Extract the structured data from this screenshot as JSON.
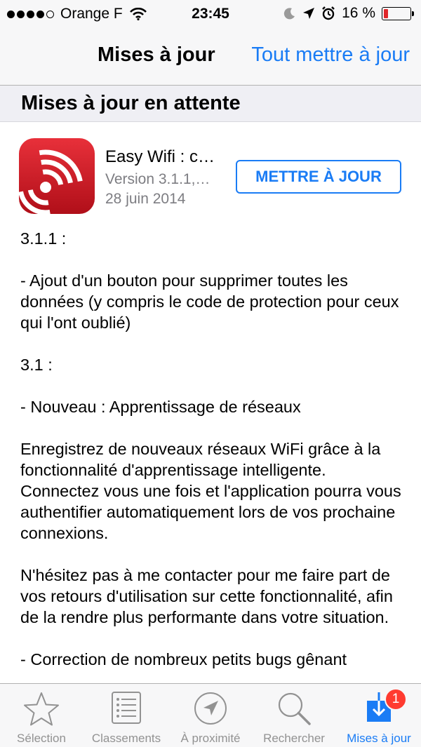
{
  "status_bar": {
    "carrier": "Orange F",
    "time": "23:45",
    "battery": "16 %",
    "battery_level": 0.16,
    "signal_bars": 4,
    "icons": [
      "wifi-icon",
      "moon-icon",
      "location-arrow-icon",
      "alarm-icon",
      "battery-icon"
    ]
  },
  "nav": {
    "title": "Mises à jour",
    "action": "Tout mettre à jour"
  },
  "section": {
    "title": "Mises à jour en attente"
  },
  "app": {
    "name": "Easy Wifi : c…",
    "version": "Version 3.1.1,…",
    "date": "28 juin 2014",
    "update_button": "METTRE À JOUR",
    "icon": "wifi-signal-icon",
    "icon_color": "#d8202b"
  },
  "notes": [
    "3.1.1 :",
    "- Ajout d'un bouton pour supprimer toutes les données (y compris le code de protection pour ceux qui l'ont oublié)",
    "3.1 :",
    "- Nouveau : Apprentissage de réseaux",
    "Enregistrez de nouveaux réseaux WiFi grâce à la fonctionnalité d'apprentissage intelligente. Connectez vous une fois et l'application pourra vous authentifier automatiquement lors de vos prochaine connexions.",
    "N'hésitez pas à me contacter pour me faire part de vos retours d'utilisation sur cette fonctionnalité, afin de la rendre plus performante dans votre situation.",
    "- Correction de nombreux petits bugs gênant"
  ],
  "tabs": [
    {
      "label": "Sélection",
      "icon": "star-icon"
    },
    {
      "label": "Classements",
      "icon": "list-icon"
    },
    {
      "label": "À proximité",
      "icon": "location-icon"
    },
    {
      "label": "Rechercher",
      "icon": "search-icon"
    },
    {
      "label": "Mises à jour",
      "icon": "download-icon",
      "badge": "1",
      "active": true
    }
  ],
  "colors": {
    "accent": "#1a7cf5",
    "badge": "#ff3b30",
    "battery_low": "#e0272a"
  }
}
